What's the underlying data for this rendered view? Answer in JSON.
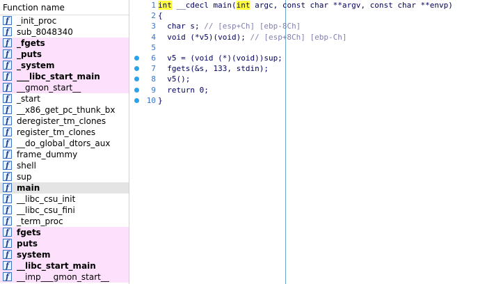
{
  "function_list": {
    "header": "Function name",
    "items": [
      {
        "name": "_init_proc",
        "style": "normal"
      },
      {
        "name": "sub_8048340",
        "style": "normal"
      },
      {
        "name": "_fgets",
        "style": "import"
      },
      {
        "name": "_puts",
        "style": "import"
      },
      {
        "name": "_system",
        "style": "import"
      },
      {
        "name": "___libc_start_main",
        "style": "import"
      },
      {
        "name": "__gmon_start__",
        "style": "import-light"
      },
      {
        "name": "_start",
        "style": "normal"
      },
      {
        "name": "__x86_get_pc_thunk_bx",
        "style": "normal"
      },
      {
        "name": "deregister_tm_clones",
        "style": "normal"
      },
      {
        "name": "register_tm_clones",
        "style": "normal"
      },
      {
        "name": "__do_global_dtors_aux",
        "style": "normal"
      },
      {
        "name": "frame_dummy",
        "style": "normal"
      },
      {
        "name": "shell",
        "style": "normal"
      },
      {
        "name": "sup",
        "style": "normal"
      },
      {
        "name": "main",
        "style": "selected"
      },
      {
        "name": "__libc_csu_init",
        "style": "normal"
      },
      {
        "name": "__libc_csu_fini",
        "style": "normal"
      },
      {
        "name": "_term_proc",
        "style": "normal"
      },
      {
        "name": "fgets",
        "style": "import"
      },
      {
        "name": "puts",
        "style": "import"
      },
      {
        "name": "system",
        "style": "import"
      },
      {
        "name": "__libc_start_main",
        "style": "import"
      },
      {
        "name": "__imp___gmon_start__",
        "style": "import-light"
      }
    ],
    "icon_glyph": "f"
  },
  "pseudocode": {
    "lines": [
      {
        "no": "1",
        "dot": false,
        "pre": "",
        "hl1": "int",
        "mid": " __cdecl main(",
        "hl2": "int",
        "post": " argc, const char **argv, const char **envp)",
        "comment": ""
      },
      {
        "no": "2",
        "dot": false,
        "pre": "{",
        "hl1": "",
        "mid": "",
        "hl2": "",
        "post": "",
        "comment": ""
      },
      {
        "no": "3",
        "dot": false,
        "pre": "  char s; ",
        "hl1": "",
        "mid": "",
        "hl2": "",
        "post": "",
        "comment": "// [esp+Ch] [ebp-8Ch]"
      },
      {
        "no": "4",
        "dot": false,
        "pre": "  void (*v5)(void); ",
        "hl1": "",
        "mid": "",
        "hl2": "",
        "post": "",
        "comment": "// [esp+8Ch] [ebp-Ch]"
      },
      {
        "no": "5",
        "dot": false,
        "pre": "",
        "hl1": "",
        "mid": "",
        "hl2": "",
        "post": "",
        "comment": ""
      },
      {
        "no": "6",
        "dot": true,
        "pre": "  v5 = (void (*)(void))sup;",
        "hl1": "",
        "mid": "",
        "hl2": "",
        "post": "",
        "comment": ""
      },
      {
        "no": "7",
        "dot": true,
        "pre": "  fgets(&s, 133, stdin);",
        "hl1": "",
        "mid": "",
        "hl2": "",
        "post": "",
        "comment": ""
      },
      {
        "no": "8",
        "dot": true,
        "pre": "  v5();",
        "hl1": "",
        "mid": "",
        "hl2": "",
        "post": "",
        "comment": ""
      },
      {
        "no": "9",
        "dot": true,
        "pre": "  return 0;",
        "hl1": "",
        "mid": "",
        "hl2": "",
        "post": "",
        "comment": ""
      },
      {
        "no": "10",
        "dot": true,
        "pre": "}",
        "hl1": "",
        "mid": "",
        "hl2": "",
        "post": "",
        "comment": ""
      }
    ]
  },
  "colors": {
    "import_highlight": "#fce0fc",
    "selected_row": "#e4e4e4",
    "keyword_highlight": "#ffff40",
    "breakpoint_dot": "#2aa3e8"
  }
}
